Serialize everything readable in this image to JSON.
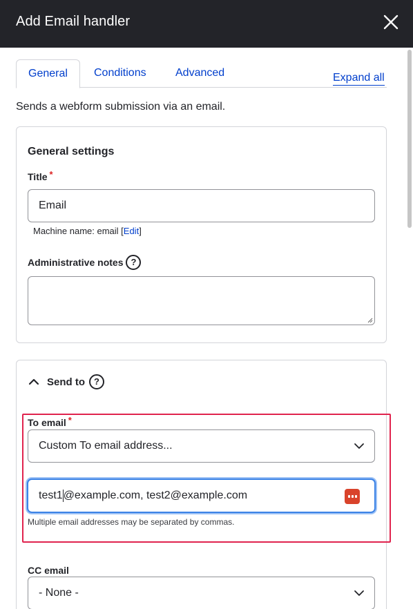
{
  "dialog": {
    "title": "Add Email handler"
  },
  "tabs": [
    {
      "label": "General",
      "active": true
    },
    {
      "label": "Conditions",
      "active": false
    },
    {
      "label": "Advanced",
      "active": false
    }
  ],
  "expand_all_label": "Expand all",
  "description": "Sends a webform submission via an email.",
  "general_settings": {
    "legend": "General settings",
    "title_label": "Title",
    "required_marker": "*",
    "title_value": "Email",
    "machine_name_prefix": "Machine name: email [",
    "machine_name_edit": "Edit",
    "machine_name_suffix": "]",
    "admin_notes_label": "Administrative notes",
    "help_glyph": "?"
  },
  "send_to": {
    "summary_label": "Send to",
    "help_glyph": "?",
    "to_email_label": "To email",
    "required_marker": "*",
    "to_email_selected": "Custom To email address...",
    "custom_email_value_before_cursor": "test1",
    "custom_email_value_after_cursor": "@example.com, test2@example.com",
    "hint": "Multiple email addresses may be separated by commas.",
    "cc_email_label": "CC email",
    "cc_email_selected": "- None -"
  },
  "colors": {
    "titlebar_bg": "#232429",
    "link": "#003ecc",
    "required": "#dc2323",
    "focus_ring": "#3b82e6",
    "highlight_box": "#e0224d",
    "password_manager_icon": "#d9432b"
  }
}
